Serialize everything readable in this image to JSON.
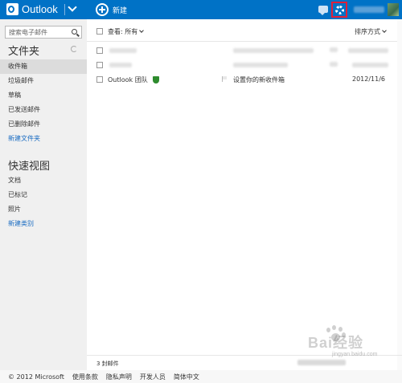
{
  "header": {
    "app_name": "Outlook",
    "new_label": "新建"
  },
  "sidebar": {
    "search_placeholder": "搜索电子邮件",
    "folders_title": "文件夹",
    "folders": [
      "收件箱",
      "垃圾邮件",
      "草稿",
      "已发送邮件",
      "已删除邮件"
    ],
    "new_folder": "新建文件夹",
    "quick_views_title": "快速视图",
    "quick_views": [
      "文档",
      "已标记",
      "照片"
    ],
    "new_category": "新建类别"
  },
  "list": {
    "view_filter": "查看: 所有",
    "sort_label": "排序方式",
    "rows": [
      {
        "sender": "Outlook 团队",
        "subject": "设置你的新收件箱",
        "date": "2012/11/6"
      }
    ],
    "count_label": "3 封邮件"
  },
  "footer": {
    "links": [
      "© 2012 Microsoft",
      "使用条款",
      "隐私声明",
      "开发人员",
      "简体中文"
    ]
  },
  "watermark": {
    "text": "Bai经验",
    "sub": "jingyan.baidu.com"
  },
  "colors": {
    "topbar": "#0072c6",
    "highlight_border": "#e0203a",
    "link": "#1a6cc2"
  }
}
